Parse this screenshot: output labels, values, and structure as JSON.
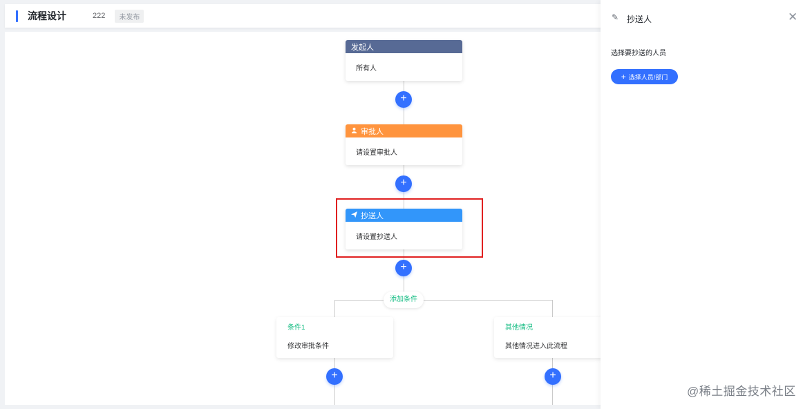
{
  "header": {
    "title": "流程设计",
    "number": "222",
    "status_badge": "未发布"
  },
  "flow": {
    "initiator": {
      "title": "发起人",
      "content": "所有人",
      "color": "#576a95"
    },
    "approver": {
      "title": "审批人",
      "content": "请设置审批人",
      "color": "#ff943e",
      "icon": "user-icon"
    },
    "cc": {
      "title": "抄送人",
      "content": "请设置抄送人",
      "color": "#3296fa",
      "icon": "send-icon"
    },
    "add_condition": "添加条件",
    "conditions": [
      {
        "title": "条件1",
        "content": "修改审批条件"
      },
      {
        "title": "其他情况",
        "content": "其他情况进入此流程"
      }
    ],
    "plus_symbol": "+"
  },
  "panel": {
    "title": "抄送人",
    "section_label": "选择要抄送的人员",
    "select_button_label": "选择人员/部门",
    "select_button_icon": "+",
    "close_symbol": "✕",
    "edit_symbol": "✎"
  },
  "watermark": "@稀土掘金技术社区",
  "colors": {
    "accent": "#3370ff",
    "condition_green": "#15bc83",
    "highlight_red": "#e02020"
  }
}
